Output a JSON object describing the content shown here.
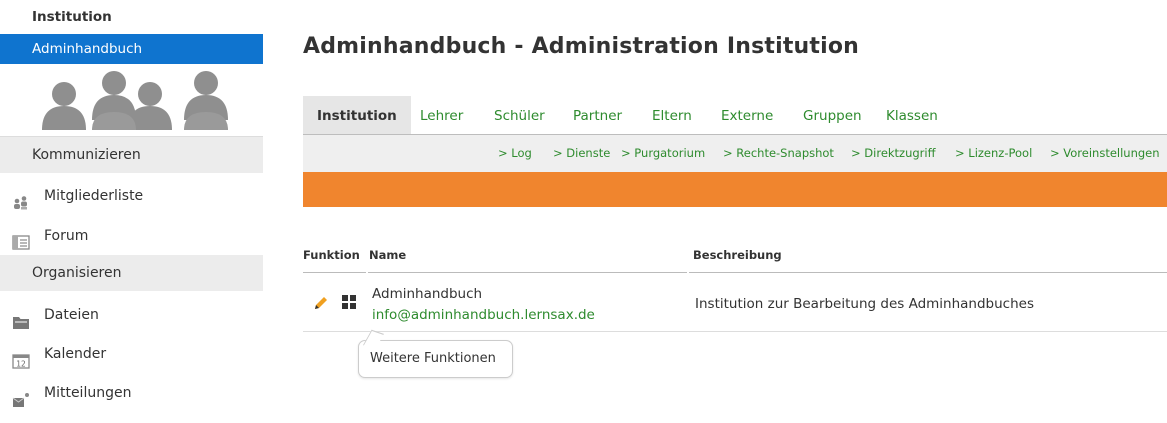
{
  "sidebar": {
    "institution_label": "Institution",
    "active_item": "Adminhandbuch",
    "sections": [
      {
        "title": "Kommunizieren"
      },
      {
        "title": "Organisieren"
      }
    ],
    "items": [
      {
        "label": "Mitgliederliste",
        "icon": "members-icon"
      },
      {
        "label": "Forum",
        "icon": "forum-icon"
      },
      {
        "label": "Dateien",
        "icon": "folder-icon"
      },
      {
        "label": "Kalender",
        "icon": "calendar-icon",
        "icon_text": "12"
      },
      {
        "label": "Mitteilungen",
        "icon": "messages-icon"
      }
    ]
  },
  "main": {
    "title": "Adminhandbuch - Administration Institution",
    "tabs": [
      "Institution",
      "Lehrer",
      "Schüler",
      "Partner",
      "Eltern",
      "Externe",
      "Gruppen",
      "Klassen"
    ],
    "active_tab": "Institution",
    "subnav": [
      "> Log",
      "> Dienste",
      "> Purgatorium",
      "> Rechte-Snapshot",
      "> Direktzugriff",
      "> Lizenz-Pool",
      "> Voreinstellungen"
    ],
    "table": {
      "headers": [
        "Funktion",
        "Name",
        "Beschreibung"
      ],
      "rows": [
        {
          "name": "Adminhandbuch",
          "email": "info@adminhandbuch.lernsax.de",
          "description": "Institution zur Bearbeitung des Adminhandbuches"
        }
      ]
    },
    "tooltip": "Weitere Funktionen"
  },
  "colors": {
    "accent_blue": "#0f74cf",
    "link_green": "#2e8b2e",
    "orange_bar": "#f0852e",
    "pencil_orange": "#f0a020"
  }
}
